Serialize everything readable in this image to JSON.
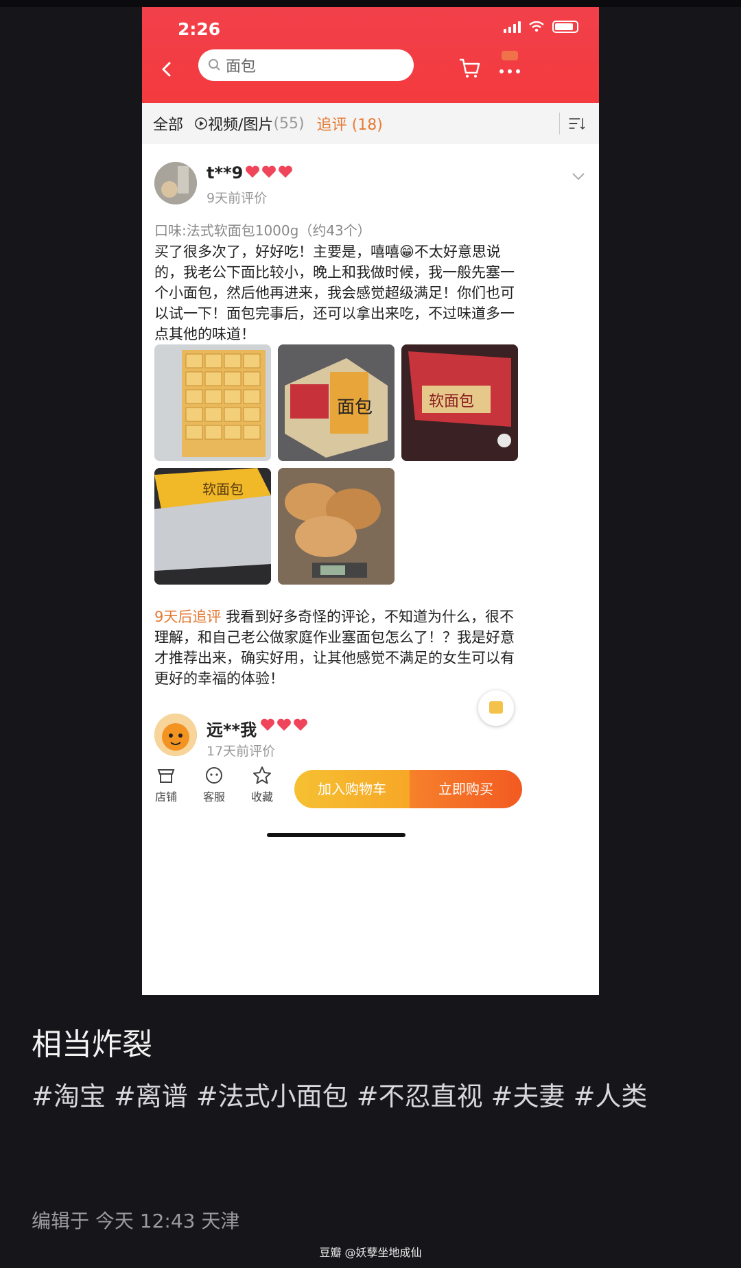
{
  "status_bar": {
    "time": "2:26"
  },
  "header": {
    "search_placeholder": "面包"
  },
  "tabs": [
    {
      "label": "全部",
      "count": ""
    },
    {
      "label": "视频/图片",
      "count": "(55)"
    },
    {
      "label": "追评",
      "count": "(18)"
    }
  ],
  "review1": {
    "user": "t**9",
    "time": "9天前评价",
    "spec": "口味:法式软面包1000g（约43个）",
    "text": "买了很多次了，好好吃！主要是，嘻嘻😁不太好意思说的，我老公下面比较小，晚上和我做时候，我一般先塞一个小面包，然后他再进来，我会感觉超级满足！你们也可以试一下！面包完事后，还可以拿出来吃，不过味道多一点其他的味道！",
    "followup_tag": "9天后追评",
    "followup_text": "我看到好多奇怪的评论，不知道为什么，很不理解，和自己老公做家庭作业塞面包怎么了！？我是好意才推荐出来，确实好用，让其他感觉不满足的女生可以有更好的幸福的体验！",
    "photo_labels": [
      "面包",
      "软面包",
      "软面包"
    ]
  },
  "review2": {
    "user": "远**我",
    "time": "17天前评价"
  },
  "bottom_bar": {
    "shop": "店铺",
    "service": "客服",
    "favorite": "收藏",
    "add_to_cart": "加入购物车",
    "buy_now": "立即购买"
  },
  "post": {
    "caption": "相当炸裂",
    "hashtags": "#淘宝 #离谱 #法式小面包 #不忍直视 #夫妻 #人类",
    "edited": "编辑于 今天 12:43 天津",
    "watermark": "豆瓣 @妖孽坐地成仙"
  },
  "colors": {
    "header_red": "#f33a3e",
    "accent_orange": "#e67a34",
    "heart_red": "#f0445a"
  }
}
